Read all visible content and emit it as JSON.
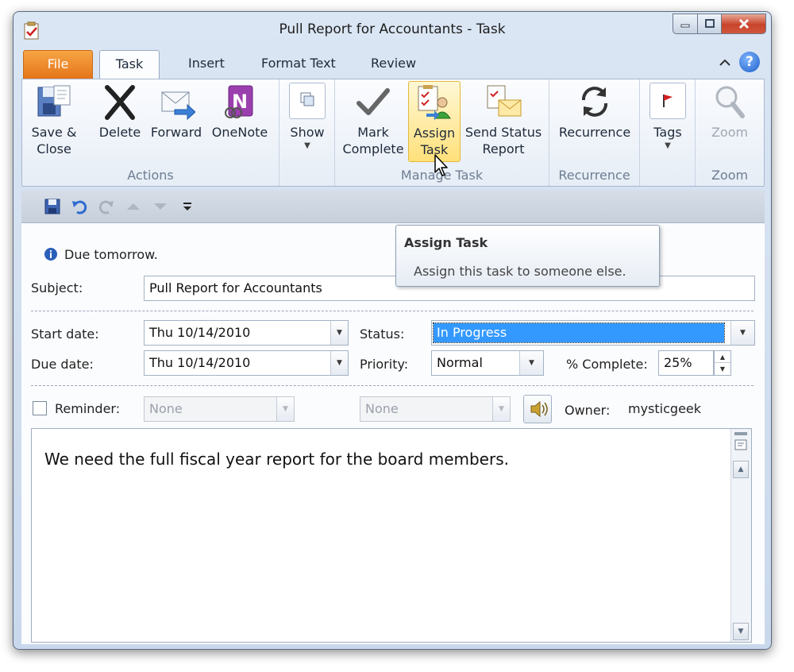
{
  "window": {
    "title": "Pull Report for Accountants  -  Task"
  },
  "tabs": {
    "file": "File",
    "task": "Task",
    "insert": "Insert",
    "format_text": "Format Text",
    "review": "Review"
  },
  "ribbon": {
    "actions": {
      "label": "Actions",
      "save_close_1": "Save &",
      "save_close_2": "Close",
      "delete": "Delete",
      "forward": "Forward",
      "onenote": "OneNote"
    },
    "show": {
      "label": "Show"
    },
    "manage_task": {
      "label": "Manage Task",
      "mark_complete_1": "Mark",
      "mark_complete_2": "Complete",
      "assign_task_1": "Assign",
      "assign_task_2": "Task",
      "send_status_1": "Send Status",
      "send_status_2": "Report"
    },
    "recurrence": {
      "button": "Recurrence",
      "label": "Recurrence"
    },
    "tags": {
      "button": "Tags"
    },
    "zoom": {
      "button": "Zoom",
      "label": "Zoom"
    }
  },
  "tooltip": {
    "title": "Assign Task",
    "description": "Assign this task to someone else."
  },
  "form": {
    "info_banner": "Due tomorrow.",
    "subject_label": "Subject:",
    "subject_value": "Pull Report for Accountants",
    "start_date_label": "Start date:",
    "start_date_value": "Thu 10/14/2010",
    "due_date_label": "Due date:",
    "due_date_value": "Thu 10/14/2010",
    "status_label": "Status:",
    "status_value": "In Progress",
    "priority_label": "Priority:",
    "priority_value": "Normal",
    "percent_label": "% Complete:",
    "percent_value": "25%",
    "reminder_label": "Reminder:",
    "reminder_date": "None",
    "reminder_time": "None",
    "owner_label": "Owner:",
    "owner_value": "mysticgeek",
    "body_text": "We need the full fiscal year report for the board members."
  },
  "colors": {
    "file_tab": "#e4741a",
    "highlight": "#ffe07a",
    "selection": "#3399ff",
    "close_button": "#c8432a"
  }
}
